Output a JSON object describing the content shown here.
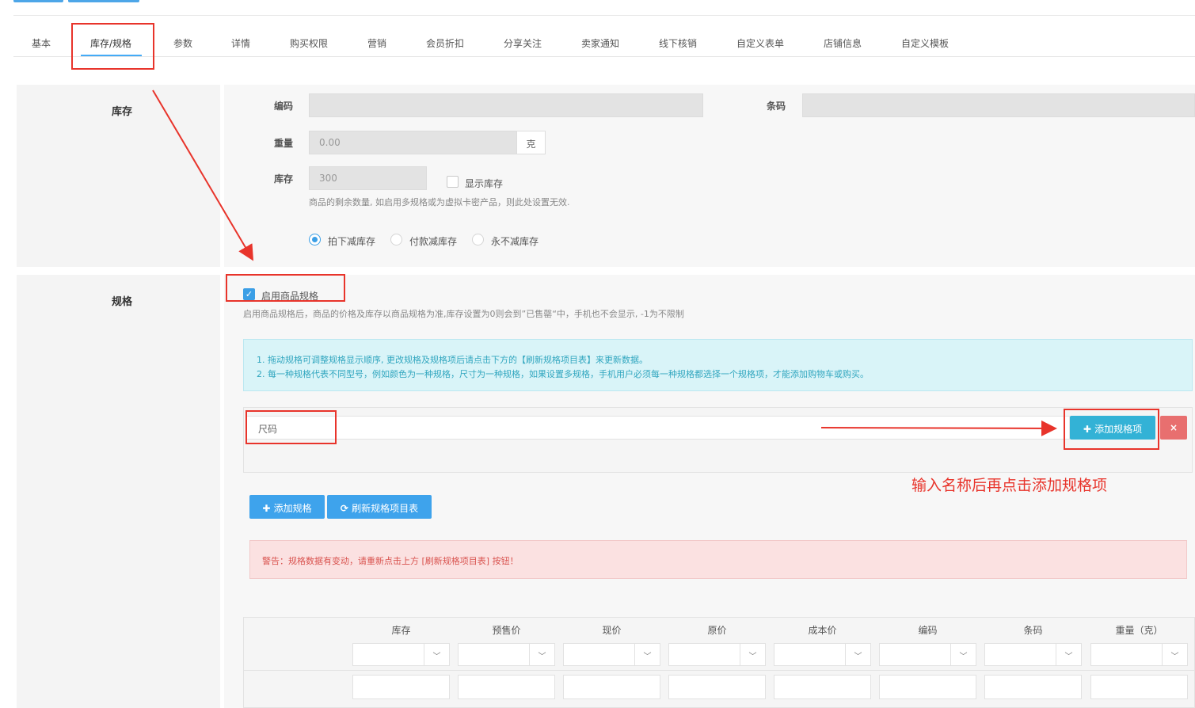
{
  "tabs": [
    "基本",
    "库存/规格",
    "参数",
    "详情",
    "购买权限",
    "营销",
    "会员折扣",
    "分享关注",
    "卖家通知",
    "线下核销",
    "自定义表单",
    "店铺信息",
    "自定义模板"
  ],
  "active_tab": "库存/规格",
  "stock_section": {
    "title": "库存",
    "code_label": "编码",
    "barcode_label": "条码",
    "weight_label": "重量",
    "weight_value": "0.00",
    "weight_unit": "克",
    "stock_label": "库存",
    "stock_value": "300",
    "show_stock_label": "显示库存",
    "stock_help": "商品的剩余数量, 如启用多规格或为虚拟卡密产品，则此处设置无效.",
    "reduce_options": [
      "拍下减库存",
      "付款减库存",
      "永不减库存"
    ],
    "reduce_selected": "拍下减库存"
  },
  "spec_section": {
    "title": "规格",
    "enable_label": "启用商品规格",
    "enable_checked": true,
    "enable_help": "启用商品规格后，商品的价格及库存以商品规格为准,库存设置为0则会到”已售罄“中，手机也不会显示, -1为不限制",
    "info_lines": [
      "1. 拖动规格可调整规格显示顺序, 更改规格及规格项后请点击下方的【刷新规格项目表】来更新数据。",
      "2. 每一种规格代表不同型号，例如颜色为一种规格，尺寸为一种规格，如果设置多规格，手机用户必须每一种规格都选择一个规格项，才能添加购物车或购买。"
    ],
    "spec_name_value": "尺码",
    "add_item_button": "添加规格项",
    "delete_button": "×",
    "annotation": "输入名称后再点击添加规格项",
    "add_spec_button": "添加规格",
    "refresh_button": "刷新规格项目表",
    "warning": "警告：规格数据有变动，请重新点击上方 [刷新规格项目表] 按钮！",
    "table_headers": [
      "库存",
      "预售价",
      "现价",
      "原价",
      "成本价",
      "编码",
      "条码",
      "重量（克）"
    ]
  },
  "colors": {
    "accent": "#3ea3ec",
    "annotation_red": "#e8342b",
    "info_bg": "#d9f4f8",
    "warning_bg": "#fbe1e1"
  }
}
